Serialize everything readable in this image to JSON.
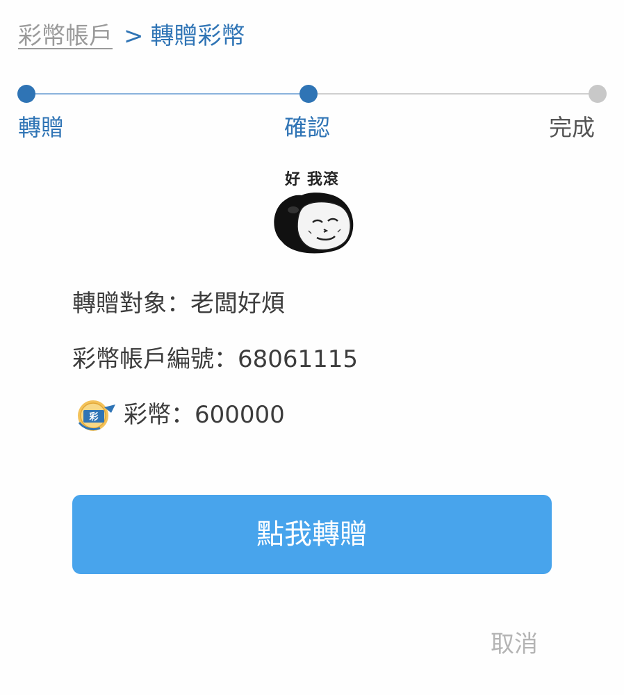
{
  "breadcrumb": {
    "parent": "彩幣帳戶",
    "separator": ">",
    "current": "轉贈彩幣"
  },
  "steps": [
    {
      "label": "轉贈",
      "state": "completed"
    },
    {
      "label": "確認",
      "state": "current"
    },
    {
      "label": "完成",
      "state": "pending"
    }
  ],
  "sticker": {
    "caption": "好 我滾",
    "icon": "panda-meme-sticker"
  },
  "details": {
    "recipient": "轉贈對象：老闆好煩",
    "account_number": "彩幣帳戶編號：68061115",
    "coins": "彩幣：600000",
    "coin_icon": "lottery-coin-icon"
  },
  "actions": {
    "confirm_label": "點我轉贈",
    "cancel_label": "取消"
  },
  "colors": {
    "accent": "#2f74b5",
    "button": "#48a4ec",
    "inactive": "#c8c8c8"
  }
}
